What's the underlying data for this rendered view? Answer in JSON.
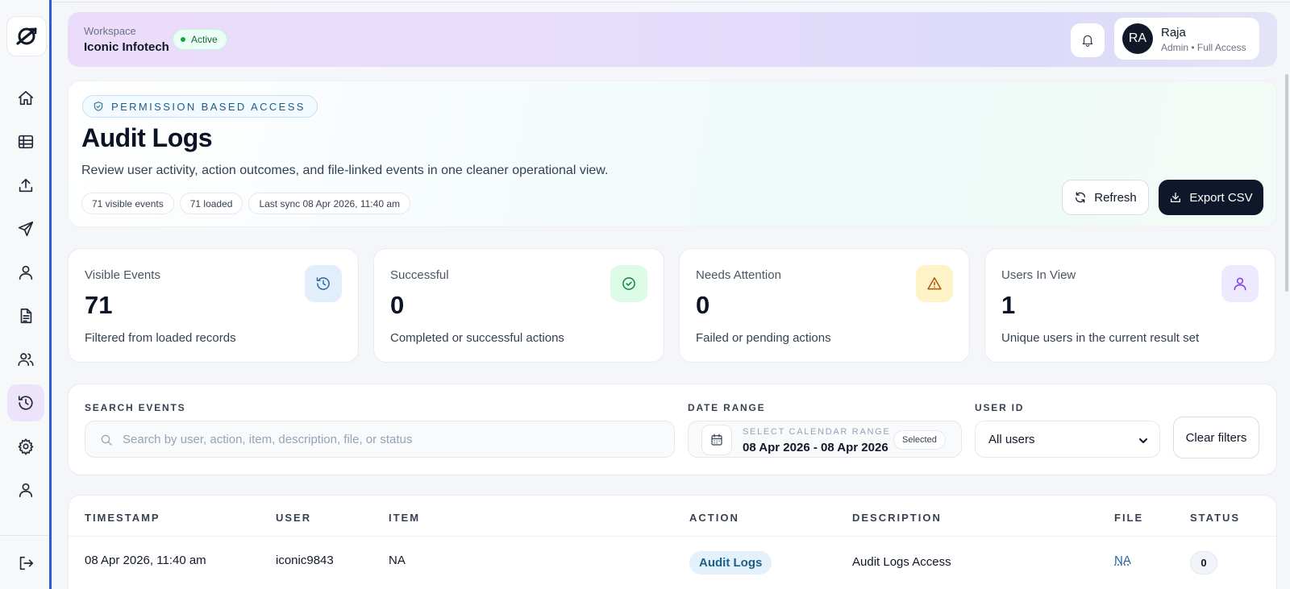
{
  "workspace": {
    "label": "Workspace",
    "name": "Iconic Infotech",
    "status": "Active"
  },
  "user": {
    "initials": "RA",
    "name": "Raja",
    "role": "Admin • Full Access"
  },
  "sidebar": {
    "items": [
      {
        "name": "home",
        "icon": "home-icon"
      },
      {
        "name": "table",
        "icon": "table-icon"
      },
      {
        "name": "upload",
        "icon": "upload-icon"
      },
      {
        "name": "send",
        "icon": "send-icon"
      },
      {
        "name": "user",
        "icon": "user-icon"
      },
      {
        "name": "document",
        "icon": "document-icon"
      },
      {
        "name": "users",
        "icon": "users-icon"
      },
      {
        "name": "audit-logs",
        "icon": "history-icon",
        "active": true
      },
      {
        "name": "settings",
        "icon": "gear-icon"
      },
      {
        "name": "profile",
        "icon": "user-icon"
      },
      {
        "name": "logout",
        "icon": "logout-icon"
      }
    ]
  },
  "hero": {
    "badge": "PERMISSION BASED ACCESS",
    "title": "Audit Logs",
    "description": "Review user activity, action outcomes, and file-linked events in one cleaner operational view.",
    "chips": [
      "71 visible events",
      "71 loaded",
      "Last sync 08 Apr 2026, 11:40 am"
    ],
    "refresh_label": "Refresh",
    "export_label": "Export CSV"
  },
  "stats": [
    {
      "label": "Visible Events",
      "value": "71",
      "sub": "Filtered from loaded records",
      "icon": "history-icon",
      "color": "#2b6aa3",
      "bg": "#e3eefb"
    },
    {
      "label": "Successful",
      "value": "0",
      "sub": "Completed or successful actions",
      "icon": "check-circle-icon",
      "color": "#15803d",
      "bg": "#dcfce7"
    },
    {
      "label": "Needs Attention",
      "value": "0",
      "sub": "Failed or pending actions",
      "icon": "warning-icon",
      "color": "#b45309",
      "bg": "#fef3c7"
    },
    {
      "label": "Users In View",
      "value": "1",
      "sub": "Unique users in the current result set",
      "icon": "user-icon",
      "color": "#7c3aed",
      "bg": "#ede9fe"
    }
  ],
  "filters": {
    "search_label": "SEARCH EVENTS",
    "search_placeholder": "Search by user, action, item, description, file, or status",
    "date_label": "DATE RANGE",
    "date_kicker": "SELECT CALENDAR RANGE",
    "date_value": "08 Apr 2026 - 08 Apr 2026",
    "date_badge": "Selected",
    "user_label": "USER ID",
    "user_value": "All users",
    "clear_label": "Clear filters"
  },
  "table": {
    "headers": [
      "TIMESTAMP",
      "USER",
      "ITEM",
      "ACTION",
      "DESCRIPTION",
      "FILE",
      "STATUS"
    ],
    "rows": [
      {
        "timestamp": "08 Apr 2026, 11:40 am",
        "user": "iconic9843",
        "item": "NA",
        "action": "Audit Logs",
        "description": "Audit Logs Access",
        "file": "NA",
        "status": "0"
      }
    ]
  }
}
